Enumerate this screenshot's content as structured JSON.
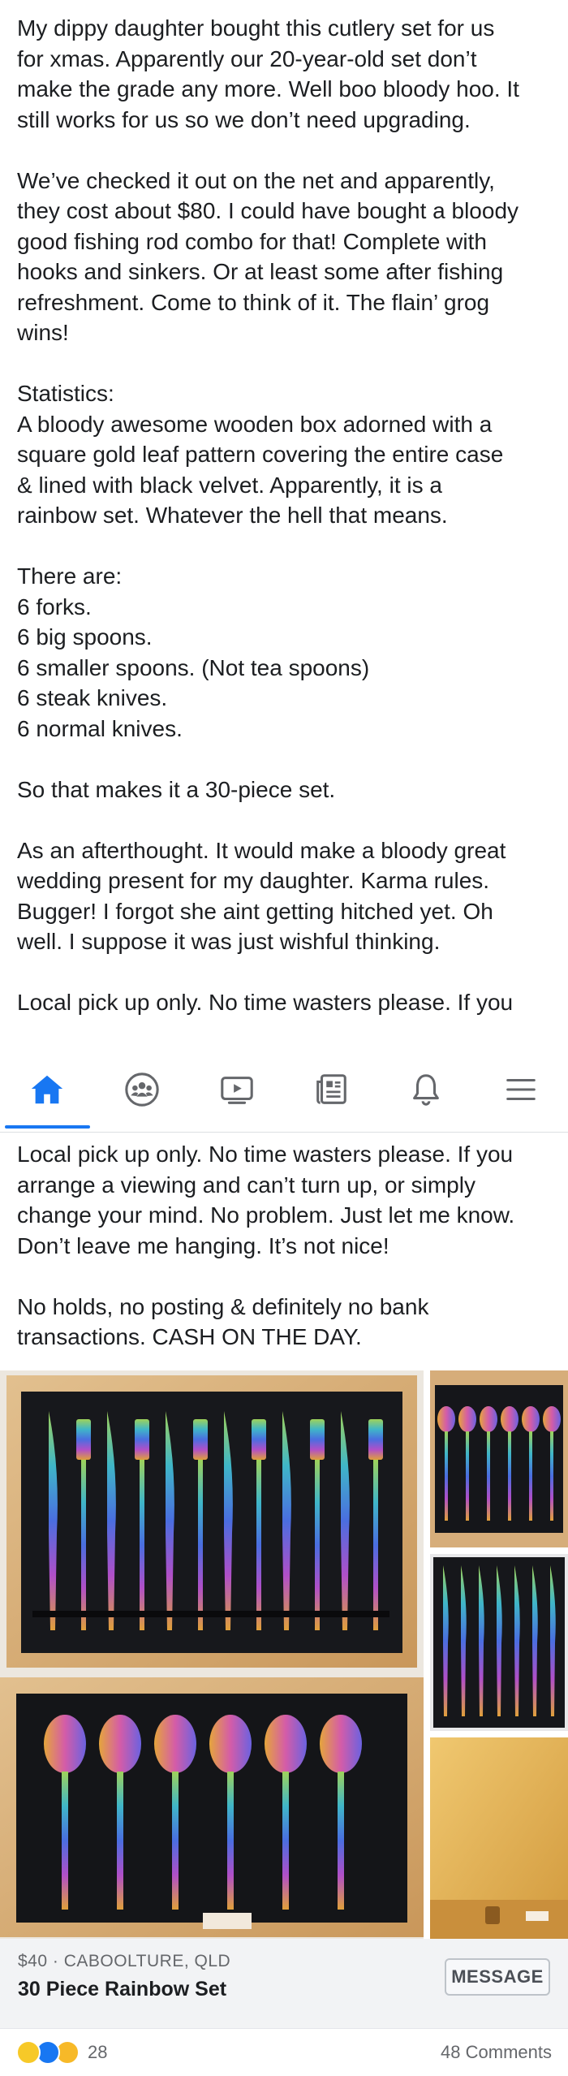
{
  "post": {
    "text_top": "My dippy daughter bought this cutlery set for us\nfor xmas. Apparently our 20-year-old set don’t\nmake the grade any more. Well boo bloody hoo. It\nstill works for us so we don’t need upgrading.\n\nWe’ve checked it out on the net and apparently,\nthey cost about $80. I could have bought a bloody\ngood fishing rod combo for that! Complete with\nhooks and sinkers. Or at least some after fishing\nrefreshment. Come to think of it. The flain’ grog\nwins!\n\nStatistics:\nA bloody awesome wooden box adorned with a\nsquare gold leaf pattern covering the entire case\n& lined with black velvet. Apparently, it is a\nrainbow set. Whatever the hell that means.\n\nThere are:\n6 forks.\n6 big spoons.\n6 smaller spoons. (Not tea spoons)\n6 steak knives.\n6 normal knives.\n\nSo that makes it a 30-piece set.\n\nAs an afterthought. It would make a bloody great\nwedding present for my daughter. Karma rules.\nBugger! I forgot she aint getting hitched yet. Oh\nwell. I suppose it was just wishful thinking.\n\nLocal pick up only. No time wasters please. If you",
    "text_bottom": "Local pick up only. No time wasters please. If you\narrange a viewing and can’t turn up, or simply\nchange your mind. No problem. Just let me know.\nDon’t leave me hanging. It’s not nice!\n\nNo holds, no posting & definitely no bank\ntransactions. CASH ON THE DAY."
  },
  "nav": {
    "tabs": [
      {
        "icon": "home-icon",
        "active": true
      },
      {
        "icon": "groups-icon",
        "active": false
      },
      {
        "icon": "watch-icon",
        "active": false
      },
      {
        "icon": "news-feed-icon",
        "active": false
      },
      {
        "icon": "bell-icon",
        "active": false
      },
      {
        "icon": "menu-icon",
        "active": false
      }
    ],
    "active_color": "#1877f2",
    "inactive_color": "#65676b"
  },
  "listing": {
    "price_location": "$40 · CABOOLTURE, QLD",
    "title": "30 Piece Rainbow Set",
    "message_button": "MESSAGE"
  },
  "reactions": {
    "types": [
      "haha",
      "like",
      "wow"
    ],
    "count": "28",
    "comments": "48 Comments"
  }
}
